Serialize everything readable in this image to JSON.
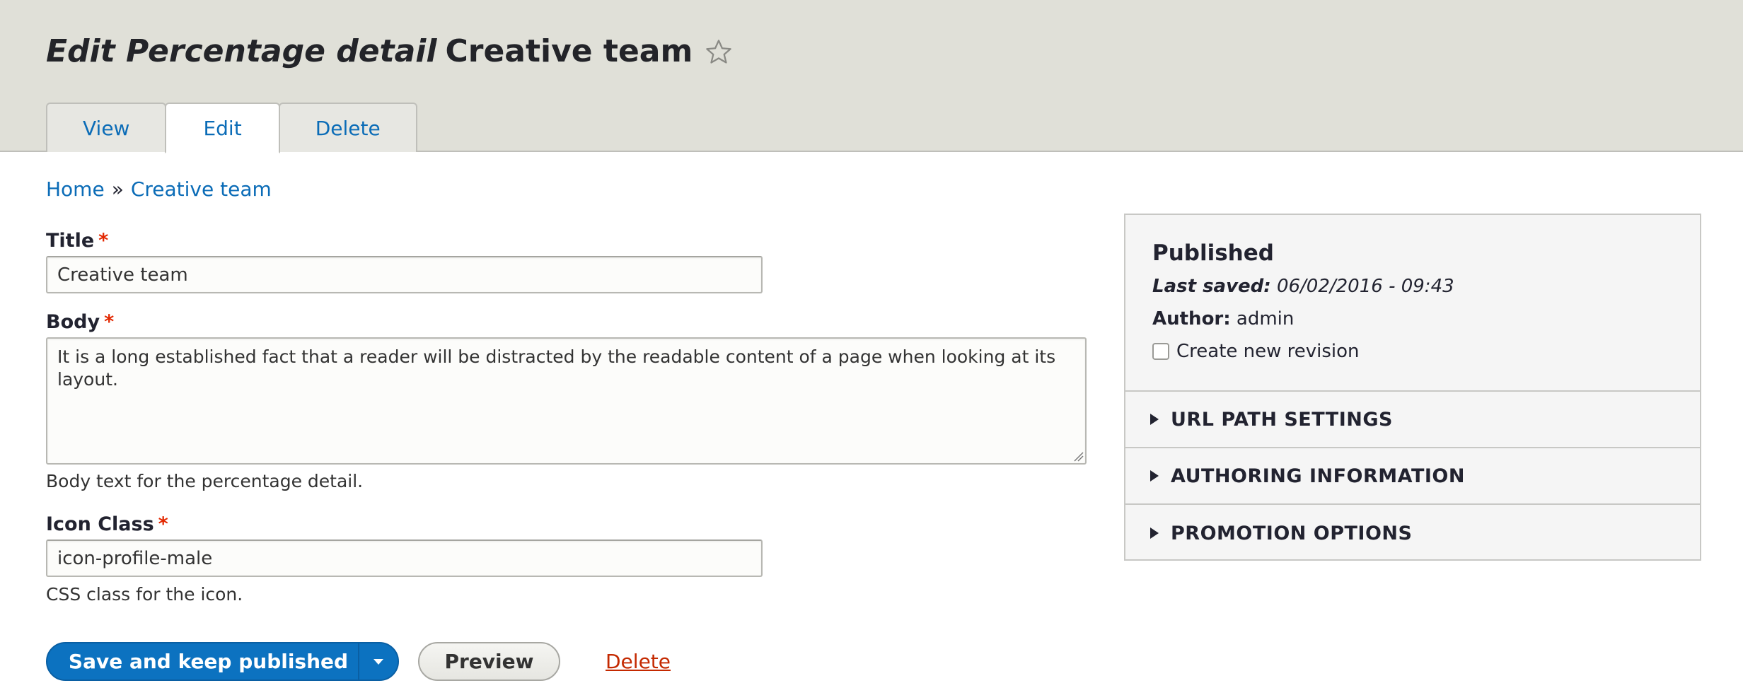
{
  "header": {
    "title_prefix": "Edit Percentage detail",
    "title_node": "Creative team",
    "tabs": [
      {
        "label": "View"
      },
      {
        "label": "Edit"
      },
      {
        "label": "Delete"
      }
    ]
  },
  "breadcrumb": {
    "home": "Home",
    "separator": "»",
    "current": "Creative team"
  },
  "form": {
    "title": {
      "label": "Title",
      "required_mark": "*",
      "value": "Creative team"
    },
    "body": {
      "label": "Body",
      "required_mark": "*",
      "value": "It is a long established fact that a reader will be distracted by the readable content of a page when looking at its layout.",
      "description": "Body text for the percentage detail."
    },
    "icon_class": {
      "label": "Icon Class",
      "required_mark": "*",
      "value": "icon-profile-male",
      "description": "CSS class for the icon."
    }
  },
  "actions": {
    "save_label": "Save and keep published",
    "preview_label": "Preview",
    "delete_label": "Delete"
  },
  "sidebar": {
    "status": "Published",
    "last_saved_label": "Last saved:",
    "last_saved_value": "06/02/2016 - 09:43",
    "author_label": "Author:",
    "author_value": "admin",
    "revision_label": "Create new revision",
    "sections": [
      {
        "label": "URL PATH SETTINGS"
      },
      {
        "label": "AUTHORING INFORMATION"
      },
      {
        "label": "PROMOTION OPTIONS"
      }
    ]
  },
  "colors": {
    "link": "#0b6cb7",
    "primary_button": "#0c72c0",
    "required": "#e32700",
    "danger_link": "#c42900",
    "header_bg": "#e0e0d8"
  }
}
